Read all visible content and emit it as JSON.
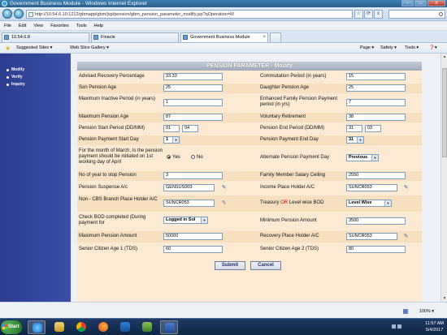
{
  "window": {
    "title": "Government Business Module - Windows Internet Explorer",
    "buttons": {
      "minimize": "–",
      "maximize": "□",
      "close": "X"
    }
  },
  "address_bar": {
    "url": "http://10.54.6.10:1212/gbmapp/gbm/jsp/pension/gbm_pension_parameter_modify.jsp?qOperation=M",
    "tools": {
      "favorite": "☆",
      "refresh": "⟳",
      "stop": "x"
    }
  },
  "menu": [
    "File",
    "Edit",
    "View",
    "Favorites",
    "Tools",
    "Help"
  ],
  "tabs": [
    {
      "label": "10.54.6.8"
    },
    {
      "label": "Finacle"
    },
    {
      "label": "Government Business Module"
    }
  ],
  "favorites_bar": {
    "suggested": "Suggested Sites ▾",
    "gallery": "Web Slice Gallery ▾",
    "page": "Page ▾",
    "safety": "Safety ▾",
    "tools": "Tools ▾",
    "help": "❓▾"
  },
  "sidebar": {
    "items": [
      "Modify",
      "Verify",
      "Inquiry"
    ]
  },
  "form": {
    "title": "PENSION PARAMETER - Modify",
    "rows": [
      {
        "left_label": "Advised Recovery Percentage",
        "left_value": "33.33",
        "right_label": "Commutation Period (in years)",
        "right_value": "15"
      },
      {
        "left_label": "Son Pension Age",
        "left_value": "25",
        "right_label": "Daughter Pension Age",
        "right_value": "25"
      },
      {
        "left_label": "Maximum Inactive Period (in years)",
        "left_value": "1",
        "right_label": "Enhanced Family Pension Payment period (in yrs)",
        "right_value": "7"
      },
      {
        "left_label": "Maximum Pension Age",
        "left_value": "87",
        "right_label": "Voluntary Retirement",
        "right_value": "38"
      },
      {
        "left_label": "Pension Start Period (DD/MM)",
        "left_value": "01",
        "left_value2": "04",
        "right_label": "Pension End Period (DD/MM)",
        "right_value": "31",
        "right_value2": "03"
      },
      {
        "left_label": "Pension Payment Start Day",
        "left_value": "1",
        "right_label": "Pension Payment End Day",
        "right_value": "31"
      },
      {
        "left_label": "For the month of March, Is the pension payment should be initiated on 1st working day of April",
        "radio_yes": "Yes",
        "radio_no": "No",
        "right_label": "Alternate Pension Payment Day",
        "right_value": "Previous"
      },
      {
        "left_label": "No of year to stop Pension",
        "left_value": "3",
        "right_label": "Family Member Salary Ceiling",
        "right_value": "2550"
      },
      {
        "left_label": "Pension Suspense A/c",
        "left_value": "GENSUS003",
        "right_label": "Income Place Holder A/C",
        "right_value": "SUNCR053"
      },
      {
        "left_label": "Non - CBS Branch Place Holder A/C",
        "left_value": "SUNCR053",
        "right_label_a": "Treasury ",
        "right_label_or": "OR",
        "right_label_b": " Level wise BOD",
        "right_value": "Level Wise"
      },
      {
        "left_label": "Check BOD completed (During payment for",
        "left_value": "Logged in Sol",
        "right_label": "Minimum Pension Amount",
        "right_value": "3500"
      },
      {
        "left_label": "Maximum Pension Amount",
        "left_value": "50000",
        "right_label": "Recovery Place Holder A/C",
        "right_value": "SUNCR053"
      },
      {
        "left_label": "Senior Citizen Age 1 (TDS)",
        "left_value": "60",
        "right_label": "Senior Citizen Age 2 (TDS)",
        "right_value": "80"
      }
    ],
    "submit_label": "Submit",
    "cancel_label": "Cancel"
  },
  "status": {
    "zoom": "100% ▾"
  },
  "taskbar": {
    "start_label": "Start",
    "time": "11:57 AM",
    "date": "5/4/2017"
  }
}
